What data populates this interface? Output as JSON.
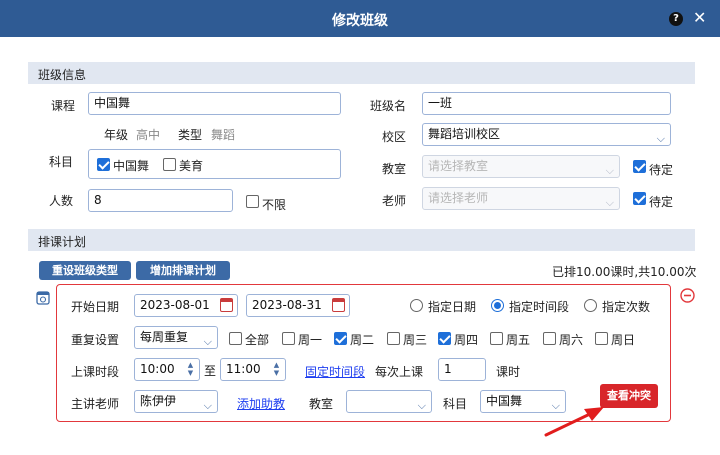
{
  "window": {
    "title": "修改班级",
    "help_label": "?",
    "close_label": "✕"
  },
  "class_info": {
    "section_title": "班级信息",
    "course_label": "课程",
    "course_value": "中国舞",
    "grade_label": "年级",
    "grade_value": "高中",
    "type_label": "类型",
    "type_value": "舞蹈",
    "subject_label": "科目",
    "subjects": [
      {
        "label": "中国舞",
        "checked": true
      },
      {
        "label": "美育",
        "checked": false
      }
    ],
    "count_label": "人数",
    "count_value": "8",
    "unlimited_label": "不限",
    "class_name_label": "班级名",
    "class_name_value": "一班",
    "campus_label": "校区",
    "campus_value": "舞蹈培训校区",
    "classroom_label": "教室",
    "classroom_placeholder": "请选择教室",
    "teacher_label": "老师",
    "teacher_placeholder": "请选择老师",
    "pending_label": "待定"
  },
  "schedule": {
    "section_title": "排课计划",
    "reset_type_button": "重设班级类型",
    "add_plan_button": "增加排课计划",
    "summary": "已排10.00课时,共10.00次",
    "start_date_label": "开始日期",
    "start_date": "2023-08-01",
    "end_date": "2023-08-31",
    "mode_options": [
      {
        "label": "指定日期",
        "checked": false
      },
      {
        "label": "指定时间段",
        "checked": true
      },
      {
        "label": "指定次数",
        "checked": false
      }
    ],
    "repeat_label": "重复设置",
    "repeat_value": "每周重复",
    "days": [
      {
        "label": "全部",
        "checked": false
      },
      {
        "label": "周一",
        "checked": false
      },
      {
        "label": "周二",
        "checked": true
      },
      {
        "label": "周三",
        "checked": false
      },
      {
        "label": "周四",
        "checked": true
      },
      {
        "label": "周五",
        "checked": false
      },
      {
        "label": "周六",
        "checked": false
      },
      {
        "label": "周日",
        "checked": false
      }
    ],
    "time_label": "上课时段",
    "time_start": "10:00",
    "to_label": "至",
    "time_end": "11:00",
    "fixed_period_link": "固定时间段",
    "per_class_label": "每次上课",
    "per_class_value": "1",
    "hours_unit": "课时",
    "main_teacher_label": "主讲老师",
    "main_teacher_value": "陈伊伊",
    "add_assistant_link": "添加助教",
    "room_label": "教室",
    "room_value": "",
    "subject_label": "科目",
    "subject_value": "中国舞",
    "conflict_button": "查看冲突"
  },
  "colors": {
    "title_bar": "#2f5b94",
    "accent": "#1e6fd9",
    "danger": "#d8262a"
  }
}
